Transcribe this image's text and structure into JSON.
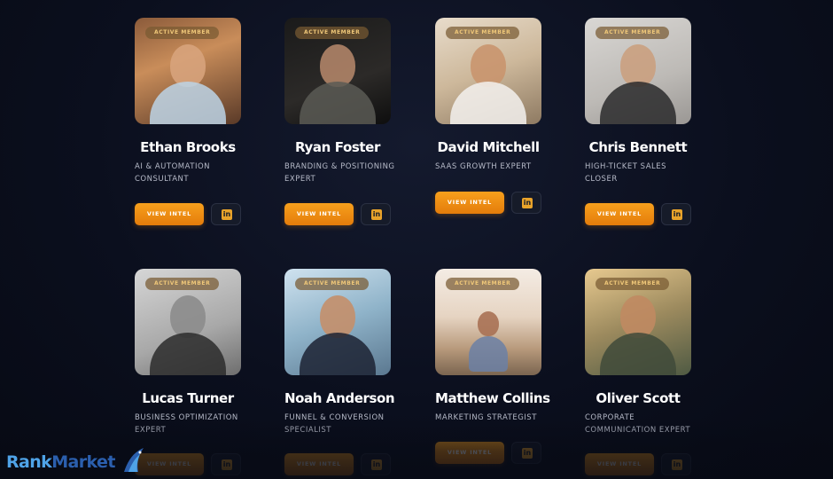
{
  "badge_text": "ACTIVE MEMBER",
  "view_button_label": "VIEW INTEL",
  "linkedin_glyph": "in",
  "accent_color": "#f59a1a",
  "logo": {
    "part1": "Rank",
    "part2": "Market"
  },
  "members": [
    {
      "name": "Ethan Brooks",
      "role_lines": [
        "AI & AUTOMATION",
        "CONSULTANT"
      ]
    },
    {
      "name": "Ryan Foster",
      "role_lines": [
        "BRANDING & POSITIONING",
        "EXPERT"
      ]
    },
    {
      "name": "David Mitchell",
      "role_lines": [
        "SAAS GROWTH EXPERT",
        ""
      ]
    },
    {
      "name": "Chris Bennett",
      "role_lines": [
        "HIGH-TICKET SALES",
        "CLOSER"
      ]
    },
    {
      "name": "Lucas Turner",
      "role_lines": [
        "BUSINESS OPTIMIZATION",
        "EXPERT"
      ]
    },
    {
      "name": "Noah Anderson",
      "role_lines": [
        "FUNNEL & CONVERSION",
        "SPECIALIST"
      ]
    },
    {
      "name": "Matthew Collins",
      "role_lines": [
        "MARKETING STRATEGIST",
        ""
      ]
    },
    {
      "name": "Oliver Scott",
      "role_lines": [
        "CORPORATE",
        "COMMUNICATION EXPERT"
      ]
    }
  ]
}
